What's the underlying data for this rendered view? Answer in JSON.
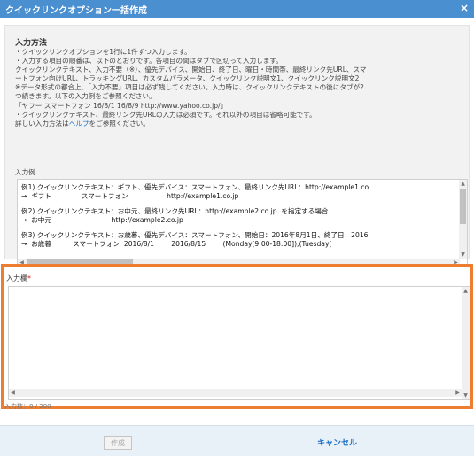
{
  "dialog": {
    "title": "クイックリンクオプション一括作成",
    "close_icon": "×"
  },
  "info": {
    "heading": "入力方法",
    "lines_before_link": [
      "・クイックリンクオプションを1行に1件ずつ入力します。",
      "・入力する項目の順番は、以下のとおりです。各項目の間はタブで区切って入力します。",
      "クイックリンクテキスト、入力不要（※）、優先デバイス、開始日、終了日、曜日・時間帯、最終リンク先URL、スマ",
      "ートフォン向けURL、トラッキングURL、カスタムパラメータ、クイックリンク説明文1、クイックリンク説明文2",
      "※データ形式の都合上、「入力不要」項目は必ず残してください。入力時は、クイックリンクテキストの後にタブが2",
      "つ続きます。以下の入力例をご参照ください。",
      "「ヤフー スマートフォン 16/8/1 16/8/9 http://www.yahoo.co.jp/」",
      "・クイックリンクテキスト、最終リンク先URLの入力は必須です。それ以外の項目は省略可能です。"
    ],
    "help_prefix": "詳しい入力方法は",
    "help_link": "ヘルプ",
    "help_suffix": "をご参照ください。",
    "example_label": "入力例"
  },
  "example": {
    "lines": [
      "例1) クイックリンクテキスト：ギフト、優先デバイス：スマートフォン、最終リンク先URL：http://example1.co",
      "→  ギフト              スマートフォン                  http://example1.co.jp",
      "",
      "例2) クイックリンクテキスト：お中元、最終リンク先URL：http://example2.co.jp  を指定する場合",
      "→  お中元                            http://example2.co.jp",
      "",
      "例3) クイックリンクテキスト：お歳暮、優先デバイス：スマートフォン、開始日：2016年8月1日、終了日：2016",
      "→  お歳暮          スマートフォン  2016/8/1        2016/8/15        (Monday[9:00-18:00]);(Tuesday["
    ]
  },
  "input": {
    "label": "入力欄",
    "required_mark": "*",
    "value": "",
    "counter": "入力数：0 / 200"
  },
  "footer": {
    "create_label": "作成",
    "cancel_label": "キャンセル"
  },
  "colors": {
    "titlebar": "#4a8fd0",
    "highlight_border": "#ed7d31",
    "link": "#1a73c9"
  }
}
